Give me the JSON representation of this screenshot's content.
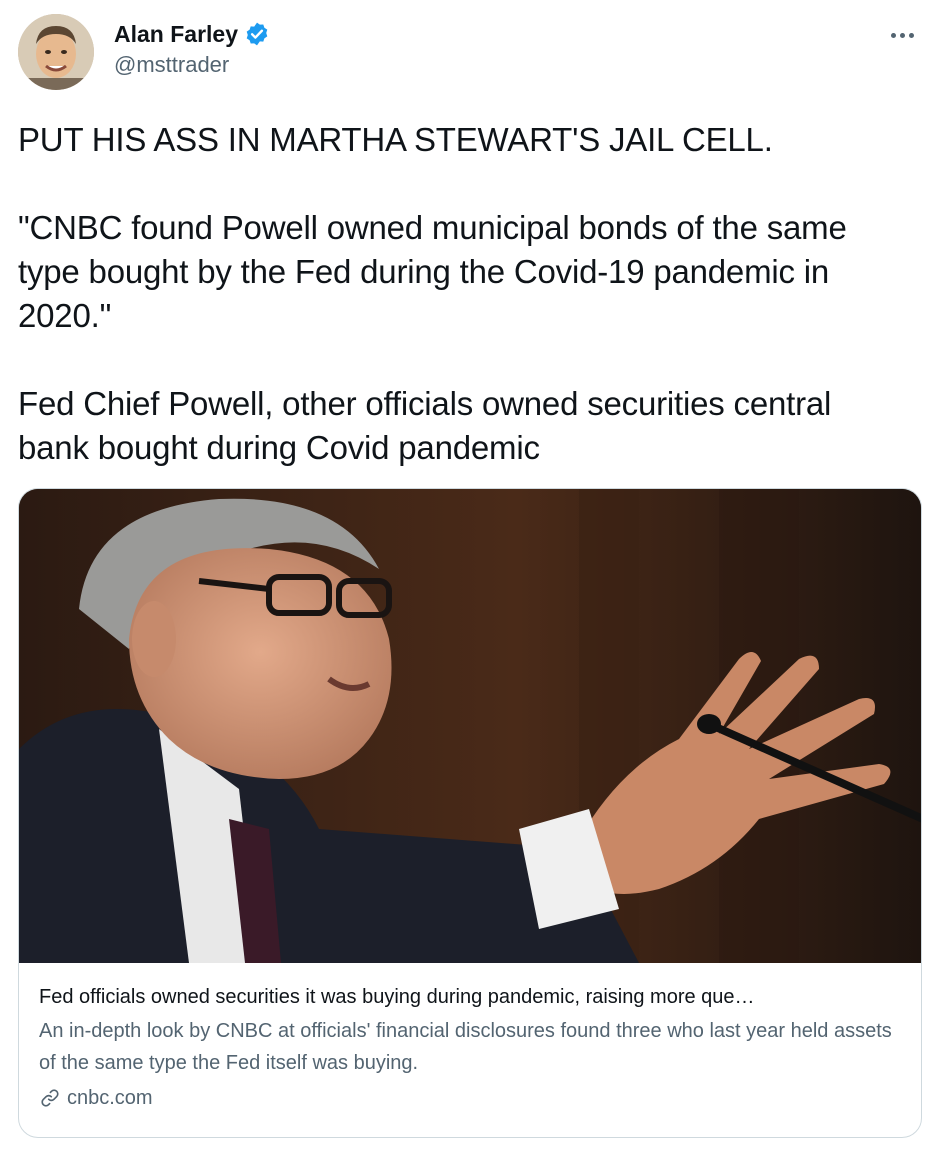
{
  "tweet": {
    "author": {
      "display_name": "Alan Farley",
      "handle": "@msttrader",
      "verified": true
    },
    "more_icon": "more-horizontal-icon",
    "text_lines": [
      "PUT HIS ASS IN MARTHA STEWART'S JAIL CELL.",
      "\"CNBC found Powell owned municipal bonds of the same type bought by the Fed during the Covid-19 pandemic in 2020.\"",
      "Fed Chief Powell, other officials owned securities central bank bought during Covid pandemic"
    ]
  },
  "card": {
    "title": "Fed officials owned securities it was buying during pandemic, raising more que…",
    "description": "An in-depth look by CNBC at officials' financial disclosures found three who last year held assets of the same type the Fed itself was buying.",
    "domain": "cnbc.com",
    "link_icon": "link-icon"
  },
  "colors": {
    "text_primary": "#0f1419",
    "text_secondary": "#536471",
    "verified_blue": "#1d9bf0",
    "border": "#cfd9de"
  }
}
